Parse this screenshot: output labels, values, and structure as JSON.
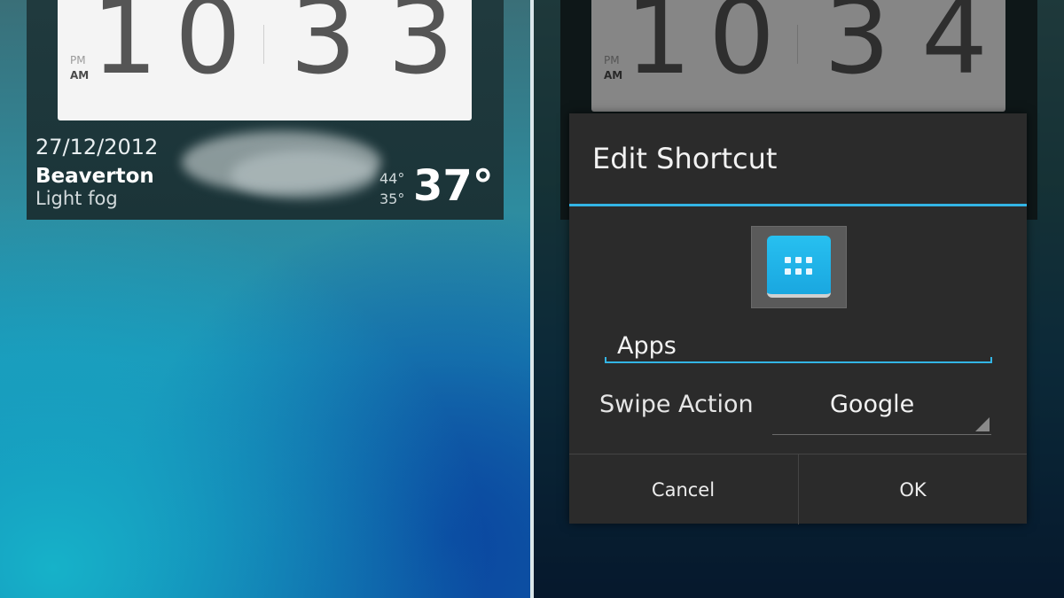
{
  "left_screen": {
    "clock": {
      "ampm_top": "PM",
      "ampm_bottom": "AM",
      "h1": "1",
      "h2": "0",
      "m1": "3",
      "m2": "3"
    },
    "weather": {
      "date": "27/12/2012",
      "city": "Beaverton",
      "condition": "Light fog",
      "high": "44°",
      "low": "35°",
      "temperature": "37°"
    }
  },
  "right_screen": {
    "clock": {
      "ampm_top": "PM",
      "ampm_bottom": "AM",
      "h1": "1",
      "h2": "0",
      "m1": "3",
      "m2": "4"
    },
    "dialog": {
      "title": "Edit Shortcut",
      "icon": "apps-grid-icon",
      "name_value": "Apps",
      "swipe_label": "Swipe Action",
      "swipe_value": "Google",
      "cancel_label": "Cancel",
      "ok_label": "OK"
    }
  },
  "colors": {
    "accent": "#33b5e5",
    "dialog_bg": "#2b2b2b"
  }
}
